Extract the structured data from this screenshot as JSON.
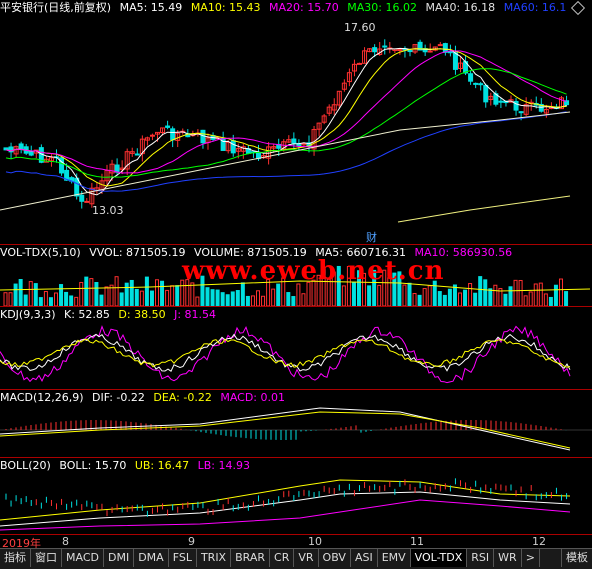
{
  "colors": {
    "white": "#ffffff",
    "yellow": "#ffff00",
    "magenta": "#ff00ff",
    "green": "#00ff00",
    "cyan": "#00e0e0",
    "blue": "#2040ff",
    "red": "#ff3030",
    "gray": "#c0c0c0"
  },
  "main": {
    "title": "平安银行(日线,前复权)",
    "ma5": "MA5: 15.49",
    "ma10": "MA10: 15.43",
    "ma20": "MA20: 15.70",
    "ma30": "MA30: 16.02",
    "ma40": "MA40: 16.18",
    "ma60": "MA60: 16.1",
    "high_label": "17.60",
    "low_label": "13.03",
    "fin_marker": "财",
    "nav_icon": "diamond-icon"
  },
  "volume": {
    "name": "VOL-TDX(5,10)",
    "vvol": "VVOL: 871505.19",
    "volume": "VOLUME: 871505.19",
    "ma5": "MA5: 660716.31",
    "ma10": "MA10: 586930.56"
  },
  "watermark": "www.eweb.net.cn",
  "kdj": {
    "name": "KDJ(9,3,3)",
    "k": "K: 52.85",
    "d": "D: 38.50",
    "j": "J: 81.54"
  },
  "macd": {
    "name": "MACD(12,26,9)",
    "dif": "DIF: -0.22",
    "dea": "DEA: -0.22",
    "macd": "MACD: 0.01"
  },
  "boll": {
    "name": "BOLL(20)",
    "boll": "BOLL: 15.70",
    "ub": "UB: 16.47",
    "lb": "LB: 14.93"
  },
  "xaxis": {
    "labels": [
      "2019年",
      "8",
      "9",
      "10",
      "11",
      "12"
    ]
  },
  "tabs": [
    "指标",
    "窗口",
    "MACD",
    "DMI",
    "DMA",
    "FSL",
    "TRIX",
    "BRAR",
    "CR",
    "VR",
    "OBV",
    "ASI",
    "EMV",
    "VOL-TDX",
    "RSI",
    "WR",
    ">"
  ],
  "tab_right": "模板"
}
